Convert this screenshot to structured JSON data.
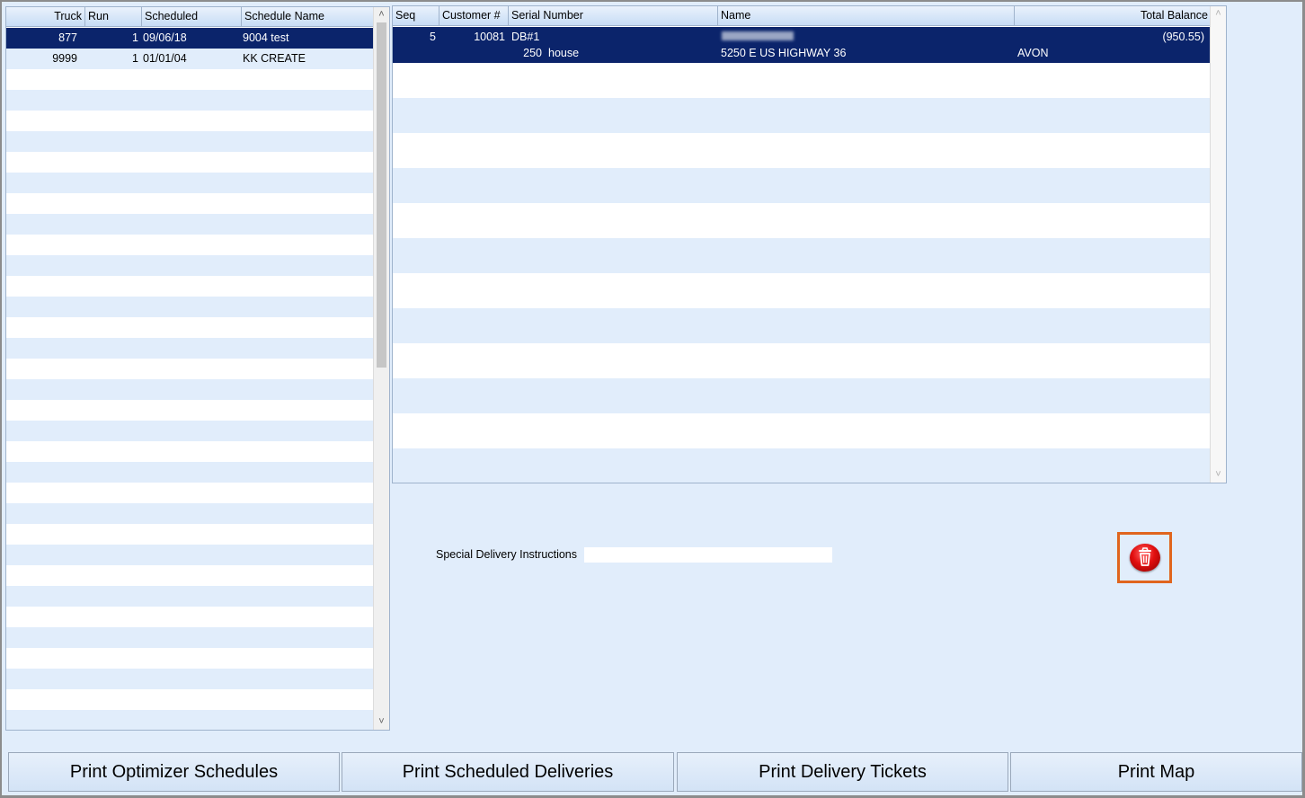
{
  "schedules": {
    "columns": [
      "Truck",
      "Run",
      "Scheduled",
      "Schedule Name"
    ],
    "rows": [
      {
        "truck": "877",
        "run": "1",
        "scheduled": "09/06/18",
        "name": "9004 test"
      },
      {
        "truck": "9999",
        "run": "1",
        "scheduled": "01/01/04",
        "name": "KK CREATE"
      }
    ]
  },
  "deliveries": {
    "columns": [
      "Seq",
      "Customer #",
      "Serial Number",
      "Name",
      "Total Balance"
    ],
    "rows": [
      {
        "seq": "5",
        "customer": "10081",
        "serial": "DB#1",
        "name": "",
        "balance": "(950.55)",
        "qty": "250",
        "tank": "house",
        "address": "5250 E US HIGHWAY 36",
        "city": "AVON"
      }
    ]
  },
  "instructions": {
    "label": "Special Delivery Instructions",
    "value": ""
  },
  "delete_icon": "trash-icon",
  "buttons": {
    "optimizer": "Print Optimizer Schedules",
    "scheduled": "Print Scheduled Deliveries",
    "tickets": "Print Delivery Tickets",
    "map": "Print Map"
  },
  "colors": {
    "background": "#e1edfb",
    "selected_row": "#0b246b",
    "highlight_border": "#e0651e"
  }
}
